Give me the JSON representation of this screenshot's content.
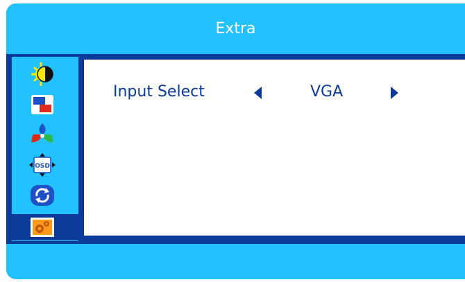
{
  "window": {
    "title": "Extra"
  },
  "sidebar": {
    "items": [
      {
        "icon": "brightness-contrast-icon",
        "selected": false
      },
      {
        "icon": "image-position-icon",
        "selected": false
      },
      {
        "icon": "color-icon",
        "selected": false
      },
      {
        "icon": "osd-settings-icon",
        "selected": false
      },
      {
        "icon": "reset-icon",
        "selected": false
      },
      {
        "icon": "extra-settings-icon",
        "selected": true
      }
    ]
  },
  "main": {
    "setting_label": "Input Select",
    "setting_value": "VGA"
  },
  "colors": {
    "background": "#22c1ff",
    "frame": "#0a3a9a",
    "text": "#0a3a9a",
    "title_text": "#ffffff"
  }
}
